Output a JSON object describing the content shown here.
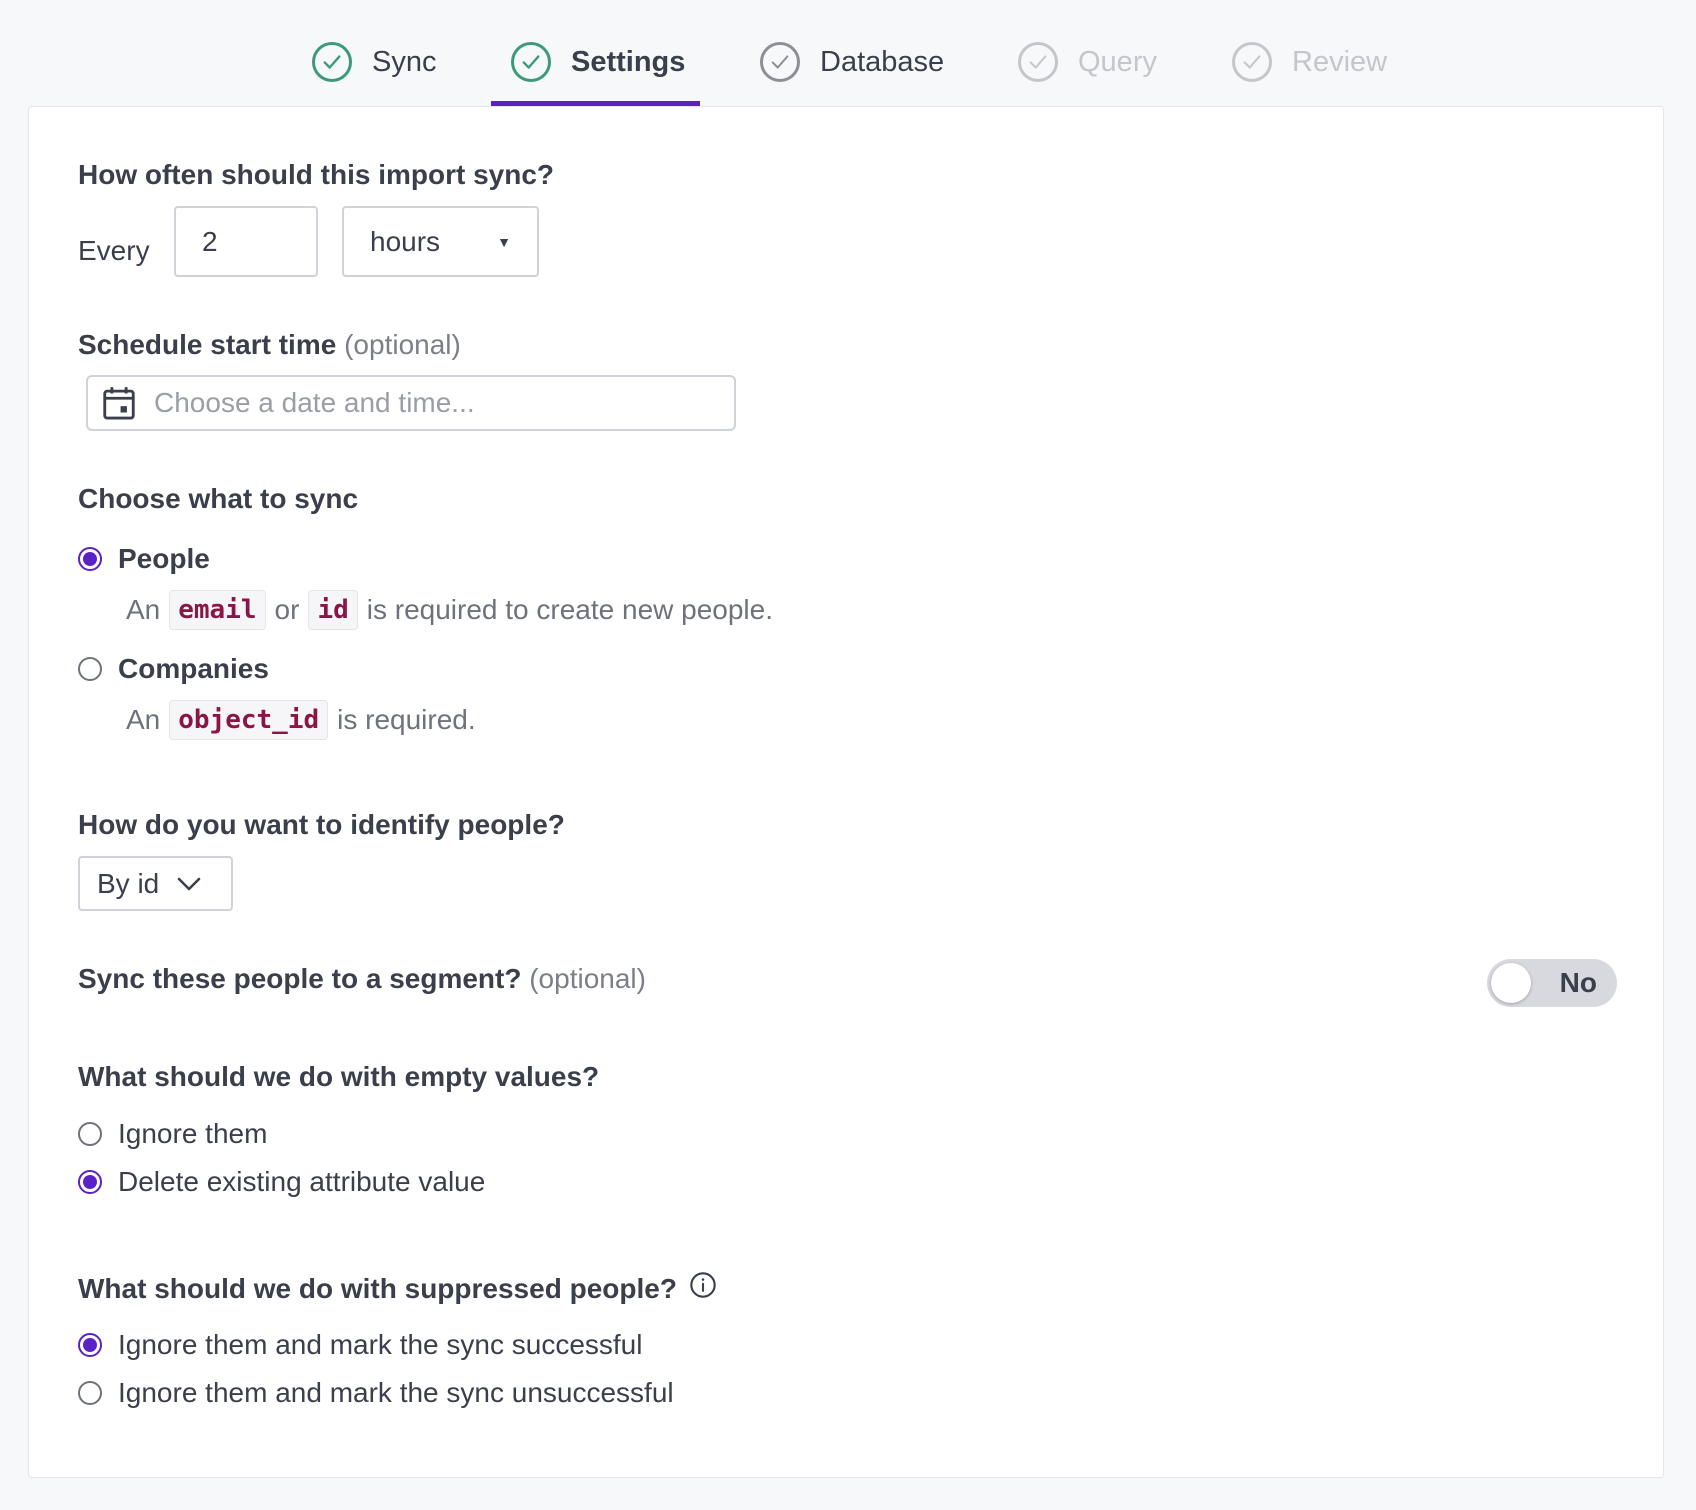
{
  "stepper": {
    "steps": [
      {
        "label": "Sync",
        "state": "done"
      },
      {
        "label": "Settings",
        "state": "done",
        "active": true
      },
      {
        "label": "Database",
        "state": "current"
      },
      {
        "label": "Query",
        "state": "pending"
      },
      {
        "label": "Review",
        "state": "pending"
      }
    ],
    "accent_color": "#5b21c9",
    "done_color": "#3d9a79"
  },
  "frequency": {
    "question": "How often should this import sync?",
    "prefix": "Every",
    "value": "2",
    "unit": "hours"
  },
  "schedule": {
    "label": "Schedule start time",
    "optional": "(optional)",
    "placeholder": "Choose a date and time..."
  },
  "sync_target": {
    "question": "Choose what to sync",
    "options": [
      {
        "label": "People",
        "selected": true,
        "hint_prefix": "An",
        "code1": "email",
        "hint_mid": "or",
        "code2": "id",
        "hint_suffix": "is required to create new people."
      },
      {
        "label": "Companies",
        "selected": false,
        "hint_prefix": "An",
        "code1": "object_id",
        "hint_suffix": "is required."
      }
    ]
  },
  "identify": {
    "question": "How do you want to identify people?",
    "value": "By id"
  },
  "segment": {
    "question": "Sync these people to a segment?",
    "optional": "(optional)",
    "toggle_label": "No",
    "toggle_on": false
  },
  "empty_values": {
    "question": "What should we do with empty values?",
    "options": [
      {
        "label": "Ignore them",
        "selected": false
      },
      {
        "label": "Delete existing attribute value",
        "selected": true
      }
    ]
  },
  "suppressed": {
    "question": "What should we do with suppressed people?",
    "options": [
      {
        "label": "Ignore them and mark the sync successful",
        "selected": true
      },
      {
        "label": "Ignore them and mark the sync unsuccessful",
        "selected": false
      }
    ]
  }
}
